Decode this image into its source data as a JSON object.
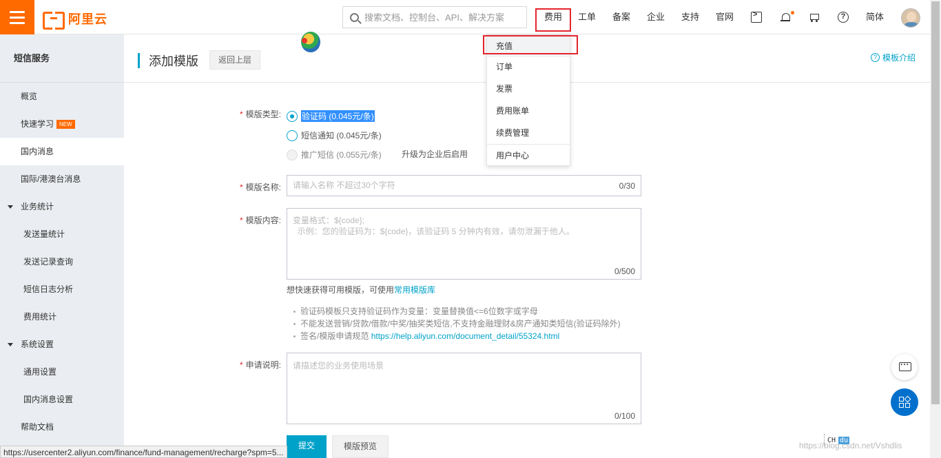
{
  "header": {
    "brand": "阿里云",
    "search_placeholder": "搜索文档、控制台、API、解决方案",
    "nav": [
      "费用",
      "工单",
      "备案",
      "企业",
      "支持",
      "官网"
    ],
    "language": "简体"
  },
  "fee_menu": {
    "items": [
      "充值",
      "订单",
      "发票",
      "费用账单",
      "续费管理",
      "用户中心"
    ],
    "highlighted": "充值"
  },
  "sidebar": {
    "title": "短信服务",
    "items": [
      "概览",
      "快速学习",
      "国内消息",
      "国际/港澳台消息"
    ],
    "new_badge": "NEW",
    "group1": "业务统计",
    "group1_items": [
      "发送量统计",
      "发送记录查询",
      "短信日志分析",
      "费用统计"
    ],
    "group2": "系统设置",
    "group2_items": [
      "通用设置",
      "国内消息设置"
    ],
    "help": "帮助文档"
  },
  "page": {
    "title": "添加模版",
    "back": "返回上层",
    "intro": "模板介绍"
  },
  "form": {
    "type_label": "模版类型:",
    "type_options": [
      "验证码 (0.045元/条)",
      "短信通知 (0.045元/条)",
      "推广短信 (0.055元/条)"
    ],
    "upgrade_link": "升级为企业后启用",
    "name_label": "模版名称:",
    "name_placeholder": "请输入名称 不超过30个字符",
    "name_counter": "0/30",
    "content_label": "模版内容:",
    "content_placeholder": "变量格式：${code};\n  示例：您的验证码为：${code}，该验证码 5 分钟内有效，请勿泄漏于他人。",
    "content_counter": "0/500",
    "quick_hint": "想快速获得可用模版，可使用",
    "quick_link": "常用模版库",
    "notes": [
      "验证码模板只支持验证码作为变量：变量替换值<=6位数字或字母",
      "不能发送营销/贷款/借款/中奖/抽奖类短信,不支持金融理财&房产通知类短信(验证码除外)",
      "签名/模版申请规范"
    ],
    "notes_link": "https://help.aliyun.com/document_detail/55324.html",
    "reason_label": "申请说明:",
    "reason_placeholder": "请描述您的业务使用场景",
    "reason_counter": "0/100",
    "submit": "提交",
    "preview": "模版预览"
  },
  "status_url": "https://usercenter2.aliyun.com/finance/fund-management/recharge?spm=5...",
  "ime": {
    "mode": "CH",
    "badge": "du"
  },
  "watermark": "https://blog.csdn.net/Vshdlis",
  "colors": {
    "accent": "#00a2ca",
    "brand": "#ff6a00",
    "highlight_box": "#e4252b"
  }
}
